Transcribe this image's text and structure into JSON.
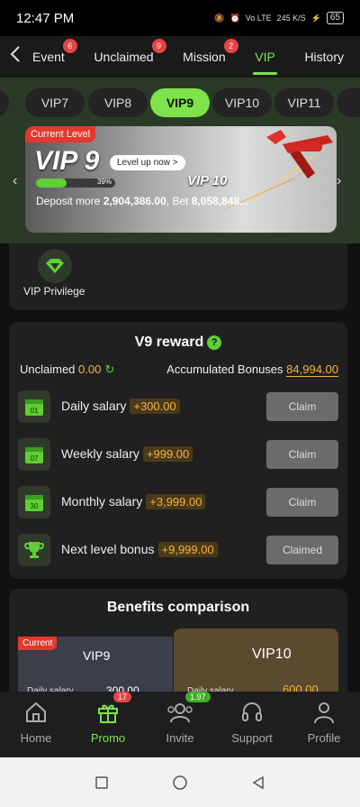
{
  "status": {
    "time": "12:47 PM",
    "net": "Vo LTE",
    "speed": "245 K/S",
    "battery": "65"
  },
  "nav": {
    "back_icon": "chevron-left-icon",
    "tabs": [
      {
        "label": "Event",
        "badge": "6"
      },
      {
        "label": "Unclaimed",
        "badge": "9"
      },
      {
        "label": "Mission",
        "badge": "2"
      },
      {
        "label": "VIP",
        "badge": ""
      },
      {
        "label": "History",
        "badge": ""
      }
    ]
  },
  "vip": {
    "levels": [
      "VIP7",
      "VIP8",
      "VIP9",
      "VIP10",
      "VIP11"
    ],
    "banner": {
      "tag": "Current Level",
      "current": "VIP 9",
      "level_up": "Level up now >",
      "progress_pct": 39,
      "progress_label": "39%",
      "next": "VIP 10",
      "deposit_prefix": "Deposit more ",
      "deposit_value": "2,904,386.00",
      "bet_prefix": ", Bet ",
      "bet_value": "8,058,848..."
    },
    "privilege_label": "VIP Privilege"
  },
  "reward": {
    "title": "V9 reward",
    "unclaimed_label": "Unclaimed",
    "unclaimed_value": "0.00",
    "accum_label": "Accumulated Bonuses",
    "accum_value": "84,994.00",
    "rows": [
      {
        "icon_text": "01",
        "name": "Daily salary",
        "amount": "+300.00",
        "button": "Claim"
      },
      {
        "icon_text": "07",
        "name": "Weekly salary",
        "amount": "+999.00",
        "button": "Claim"
      },
      {
        "icon_text": "30",
        "name": "Monthly salary",
        "amount": "+3,999.00",
        "button": "Claim"
      },
      {
        "icon_text": "",
        "name": "Next level bonus",
        "amount": "+9,999.00",
        "button": "Claimed"
      }
    ]
  },
  "benefits": {
    "title": "Benefits comparison",
    "current_tag": "Current",
    "left_title": "VIP9",
    "right_title": "VIP10",
    "left_row_label": "Daily salary",
    "left_row_value": "300.00",
    "right_row_label": "Daily salary",
    "right_row_value": "600.00"
  },
  "bottom": [
    {
      "label": "Home",
      "badge": ""
    },
    {
      "label": "Promo",
      "badge": "17"
    },
    {
      "label": "Invite",
      "badge": "1.97"
    },
    {
      "label": "Support",
      "badge": ""
    },
    {
      "label": "Profile",
      "badge": ""
    }
  ],
  "colors": {
    "accent": "#7ee24a",
    "gold": "#f2b33c",
    "badge_red": "#e84343"
  }
}
